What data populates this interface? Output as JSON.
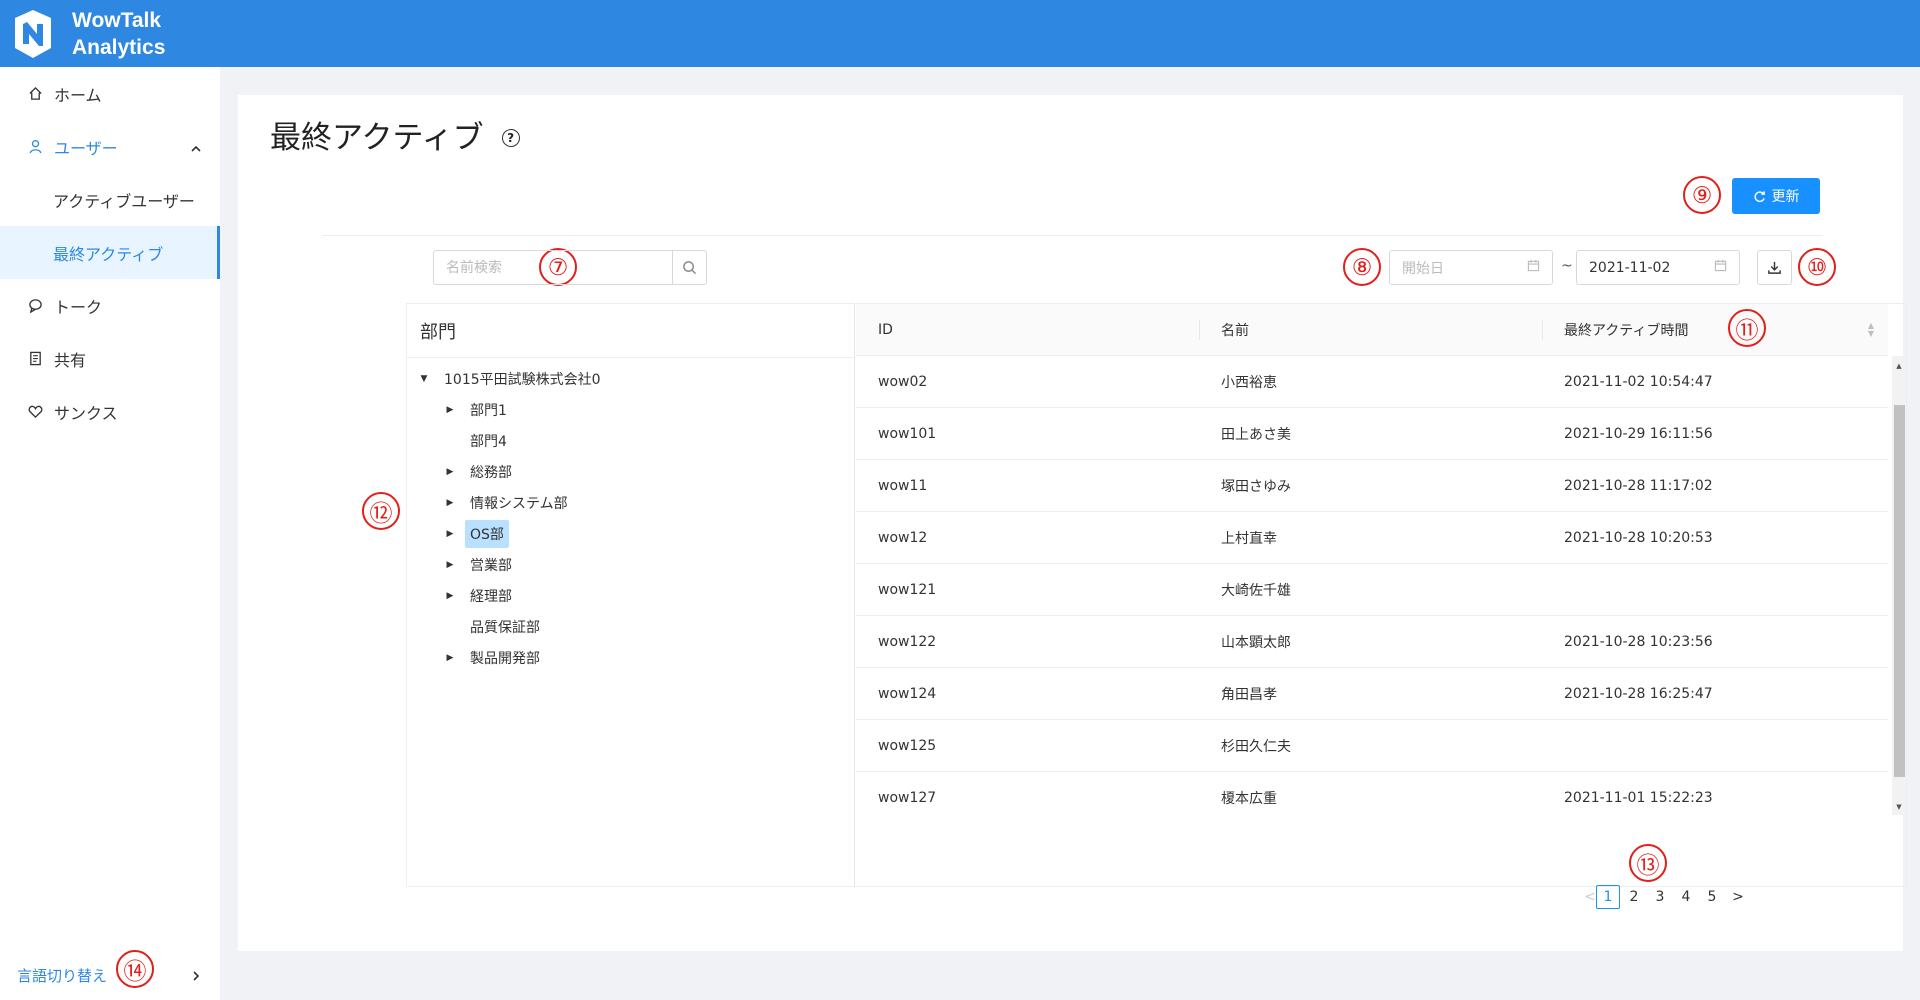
{
  "header": {
    "brand_line1": "WowTalk",
    "brand_line2": "Analytics"
  },
  "sidebar": {
    "items": [
      {
        "label": "ホーム",
        "icon": "home-icon"
      },
      {
        "label": "ユーザー",
        "icon": "user-icon"
      },
      {
        "label": "トーク",
        "icon": "chat-icon"
      },
      {
        "label": "共有",
        "icon": "share-icon"
      },
      {
        "label": "サンクス",
        "icon": "heart-icon"
      }
    ],
    "sub_items": [
      {
        "label": "アクティブユーザー"
      },
      {
        "label": "最終アクティブ"
      }
    ],
    "language": "言語切り替え"
  },
  "page": {
    "title": "最終アクティブ",
    "help_glyph": "?"
  },
  "toolbar": {
    "refresh_label": "更新",
    "search_placeholder": "名前検索",
    "start_placeholder": "開始日",
    "end_date": "2021-11-02",
    "tilde": "~"
  },
  "annotations": [
    "⑦",
    "⑧",
    "⑨",
    "⑩",
    "⑪",
    "⑫",
    "⑬",
    "⑭"
  ],
  "tree": {
    "header": "部門",
    "nodes": [
      {
        "label": "1015平田試験株式会社0",
        "toggle": "▼"
      },
      {
        "label": "部門1",
        "toggle": "▶"
      },
      {
        "label": "部門4",
        "toggle": ""
      },
      {
        "label": "総務部",
        "toggle": "▶"
      },
      {
        "label": "情報システム部",
        "toggle": "▶"
      },
      {
        "label": "OS部",
        "toggle": "▶"
      },
      {
        "label": "営業部",
        "toggle": "▶"
      },
      {
        "label": "経理部",
        "toggle": "▶"
      },
      {
        "label": "品質保証部",
        "toggle": ""
      },
      {
        "label": "製品開発部",
        "toggle": "▶"
      }
    ]
  },
  "table": {
    "columns": [
      "ID",
      "名前",
      "最終アクティブ時間"
    ],
    "rows": [
      [
        "wow02",
        "小西裕恵",
        "2021-11-02 10:54:47"
      ],
      [
        "wow101",
        "田上あさ美",
        "2021-10-29 16:11:56"
      ],
      [
        "wow11",
        "塚田さゆみ",
        "2021-10-28 11:17:02"
      ],
      [
        "wow12",
        "上村直幸",
        "2021-10-28 10:20:53"
      ],
      [
        "wow121",
        "大崎佐千雄",
        ""
      ],
      [
        "wow122",
        "山本顕太郎",
        "2021-10-28 10:23:56"
      ],
      [
        "wow124",
        "角田昌孝",
        "2021-10-28 16:25:47"
      ],
      [
        "wow125",
        "杉田久仁夫",
        ""
      ],
      [
        "wow127",
        "榎本広重",
        "2021-11-01 15:22:23"
      ]
    ]
  },
  "pagination": {
    "prev": "<",
    "next": ">",
    "pages": [
      "1",
      "2",
      "3",
      "4",
      "5"
    ],
    "current": "1"
  },
  "colors": {
    "brand": "#2e88e2",
    "primary": "#1890ff",
    "annotation": "#e0201a"
  }
}
